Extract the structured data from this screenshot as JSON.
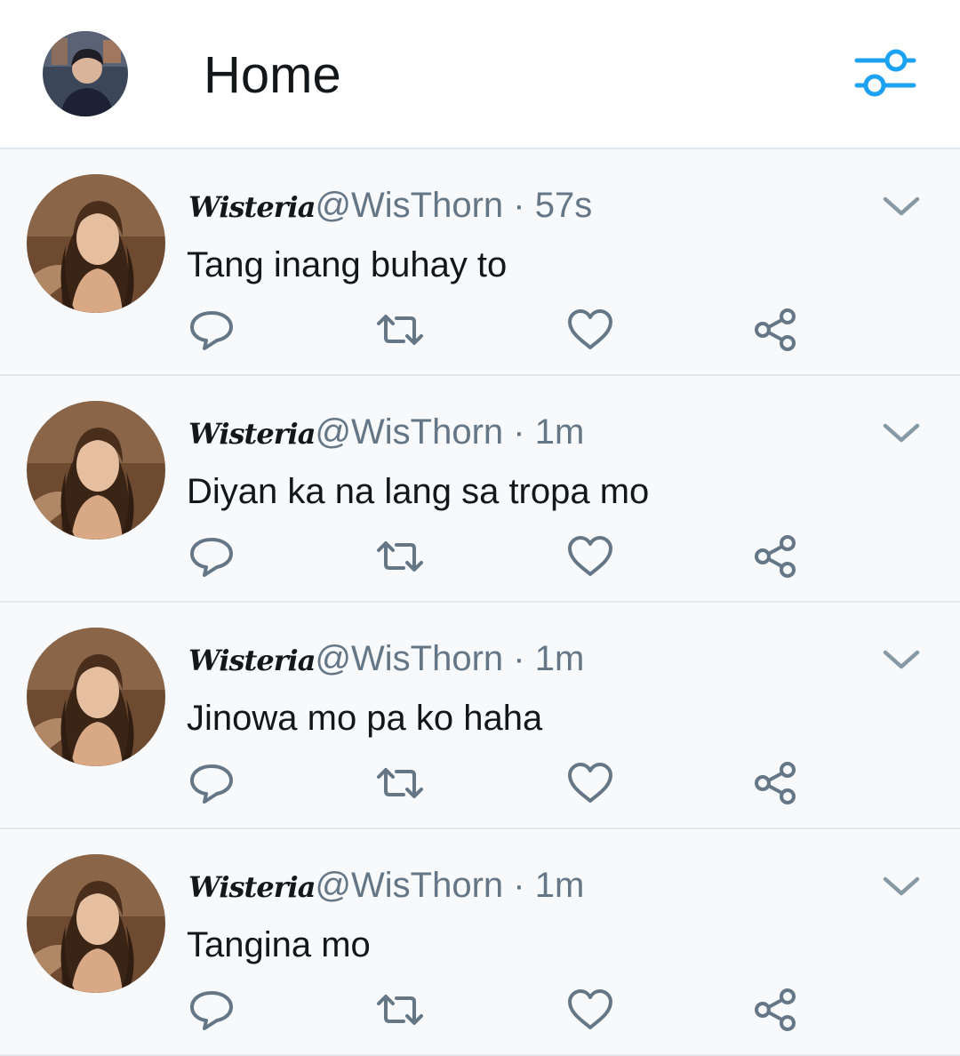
{
  "header": {
    "title": "Home",
    "avatar_icon": "user-avatar-icon",
    "filter_icon": "sliders-icon",
    "accent_color": "#1da1f2"
  },
  "tweets": [
    {
      "display_name": "Wisteria",
      "handle": "@WisThorn",
      "separator": " · ",
      "time": "57s",
      "text": "Tang inang buhay to"
    },
    {
      "display_name": "Wisteria",
      "handle": "@WisThorn",
      "separator": " · ",
      "time": "1m",
      "text": "Diyan ka na lang sa tropa mo"
    },
    {
      "display_name": "Wisteria",
      "handle": "@WisThorn",
      "separator": " · ",
      "time": "1m",
      "text": "Jinowa mo pa ko haha"
    },
    {
      "display_name": "Wisteria",
      "handle": "@WisThorn",
      "separator": " · ",
      "time": "1m",
      "text": "Tangina mo"
    }
  ],
  "action_icons": [
    "reply-icon",
    "retweet-icon",
    "like-icon",
    "share-icon"
  ],
  "colors": {
    "text_primary": "#14171a",
    "text_secondary": "#657786",
    "icon_gray": "#657786",
    "background": "#f7f9fa",
    "divider": "#e1e8ed"
  }
}
